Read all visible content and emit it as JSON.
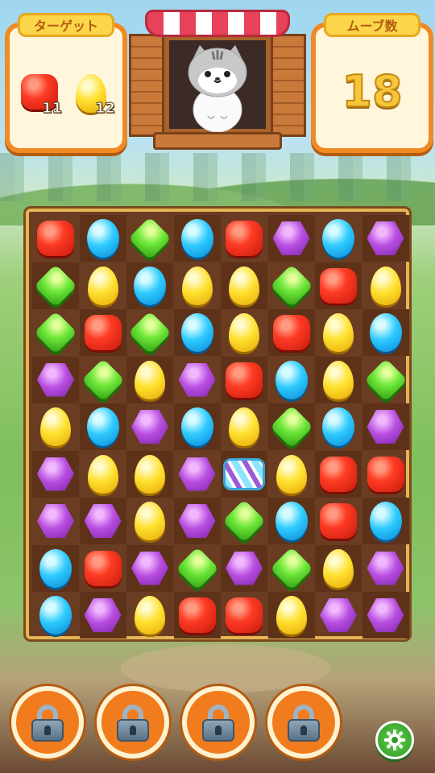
{
  "hud": {
    "target_label": "ターゲット",
    "moves_label": "ムーブ数",
    "moves_remaining": "18",
    "targets": [
      {
        "type": "red",
        "icon": "red-jelly-icon",
        "count": "11"
      },
      {
        "type": "yellow",
        "icon": "yellow-drop-icon",
        "count": "12"
      }
    ]
  },
  "board": {
    "rows": 9,
    "cols": 8,
    "cells": [
      [
        "red",
        "blue",
        "green",
        "blue",
        "red",
        "purple",
        "blue",
        "purple"
      ],
      [
        "green",
        "yellow",
        "blue",
        "yellow",
        "yellow",
        "green",
        "red",
        "yellow"
      ],
      [
        "green",
        "red",
        "green",
        "blue",
        "yellow",
        "red",
        "yellow",
        "blue"
      ],
      [
        "purple",
        "green",
        "yellow",
        "purple",
        "red",
        "blue",
        "yellow",
        "green"
      ],
      [
        "yellow",
        "blue",
        "purple",
        "blue",
        "yellow",
        "green",
        "blue",
        "purple"
      ],
      [
        "purple",
        "yellow",
        "yellow",
        "purple",
        "special",
        "yellow",
        "red",
        "red"
      ],
      [
        "purple",
        "purple",
        "yellow",
        "purple",
        "green",
        "blue",
        "red",
        "blue"
      ],
      [
        "blue",
        "red",
        "purple",
        "green",
        "purple",
        "green",
        "yellow",
        "purple"
      ],
      [
        "blue",
        "purple",
        "yellow",
        "red",
        "red",
        "yellow",
        "purple",
        "purple"
      ]
    ]
  },
  "boosters": [
    "locked",
    "locked",
    "locked",
    "locked"
  ],
  "colors": {
    "accent": "#f08a24",
    "board": "#6a3c22",
    "frame": "#e7b552"
  }
}
